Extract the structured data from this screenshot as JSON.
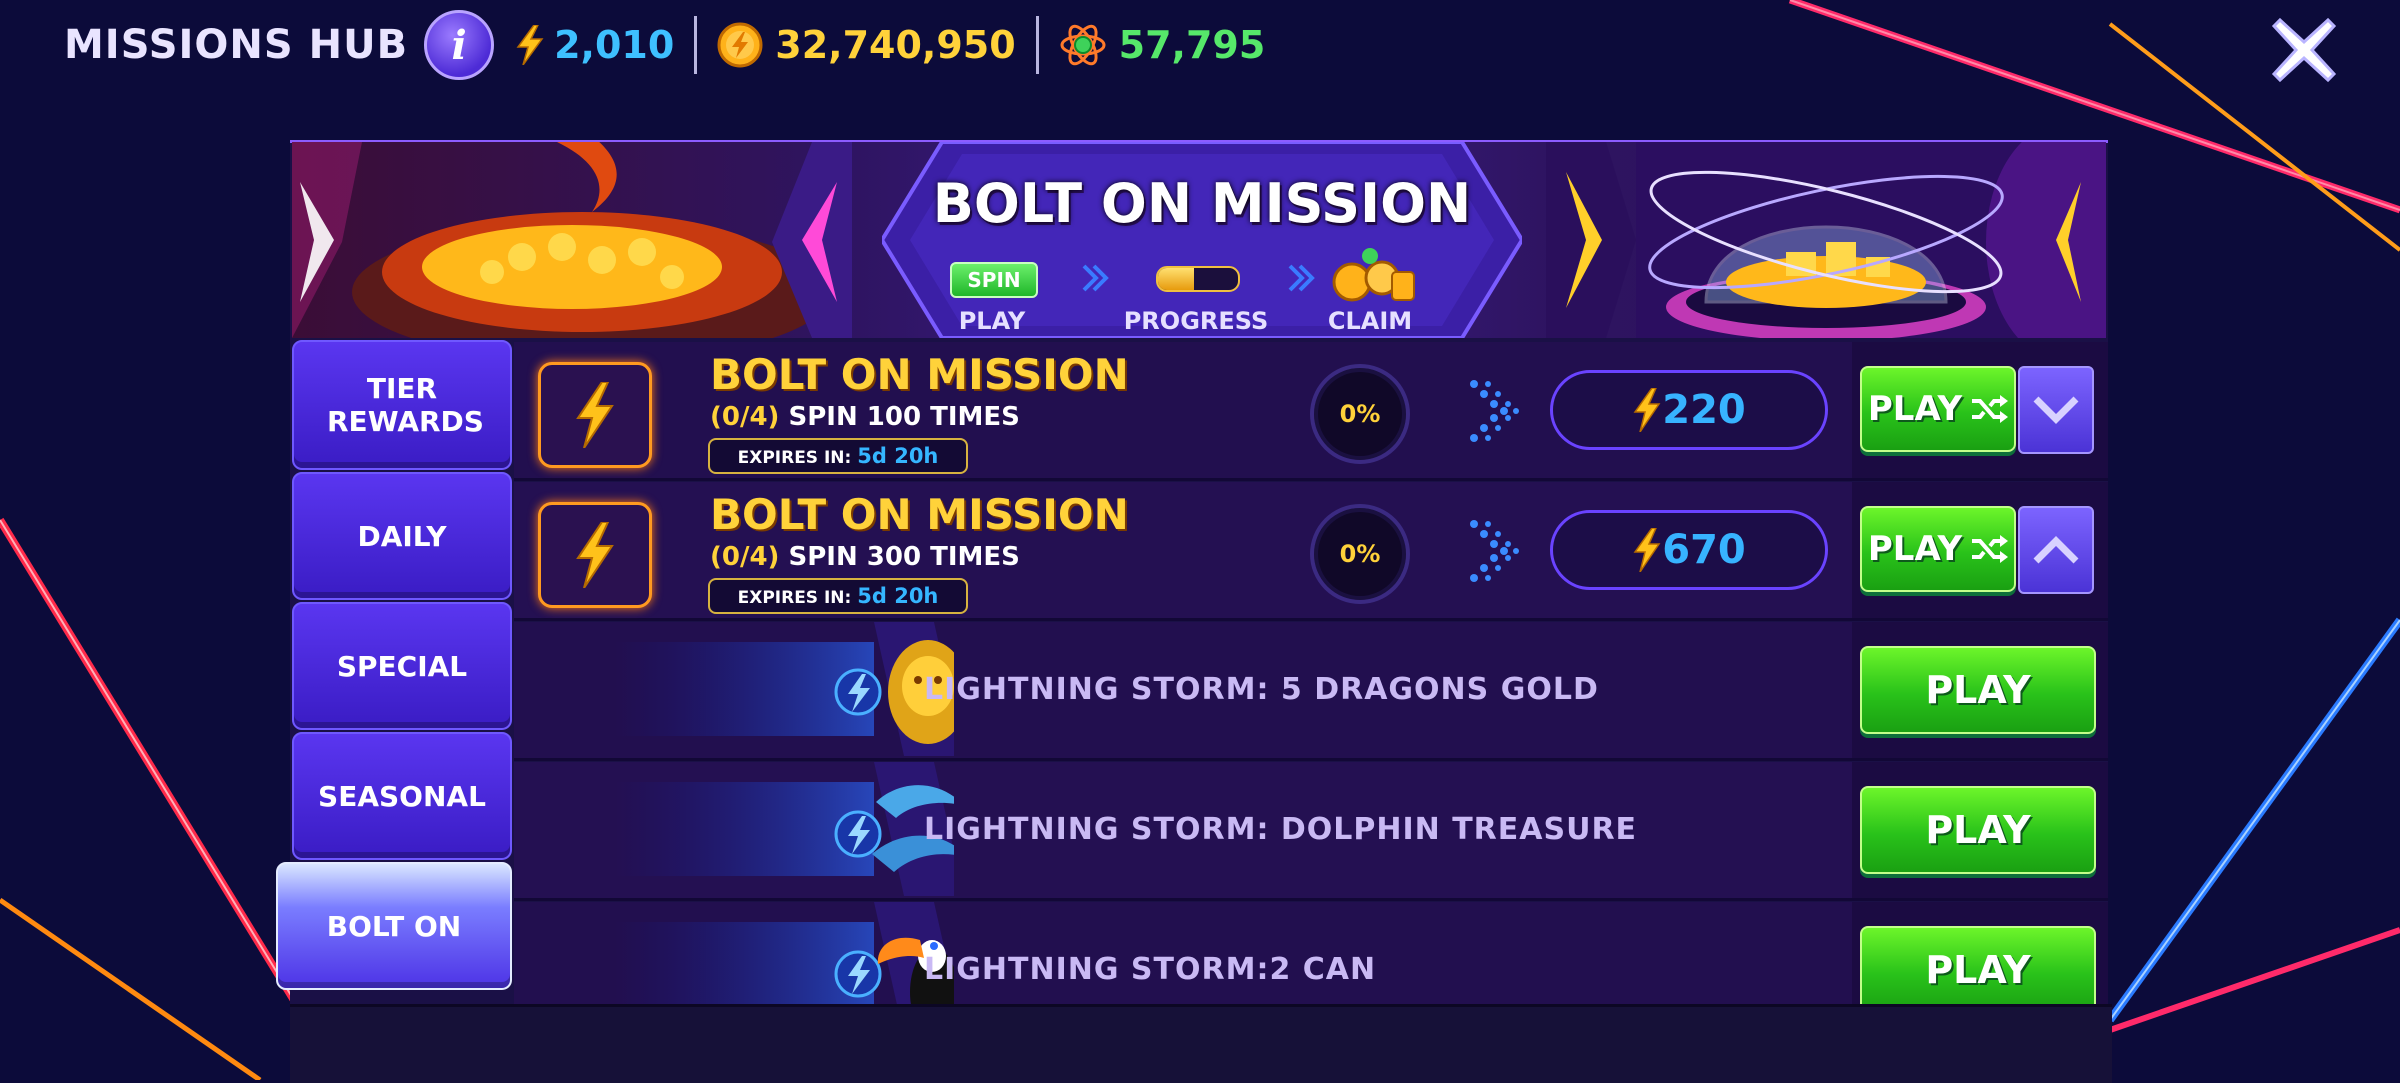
{
  "header": {
    "title": "MISSIONS HUB",
    "info_icon": "i",
    "currencies": [
      {
        "icon": "lightning-bolt-icon",
        "value": "2,010",
        "color": "#3ec0ff"
      },
      {
        "icon": "gold-coin-icon",
        "value": "32,740,950",
        "color": "#ffd23a"
      },
      {
        "icon": "atom-gem-icon",
        "value": "57,795",
        "color": "#56e86a"
      }
    ]
  },
  "banner": {
    "title": "BOLT ON MISSION",
    "steps": [
      {
        "label": "PLAY",
        "badge": "SPIN"
      },
      {
        "label": "PROGRESS",
        "progress": 0.45
      },
      {
        "label": "CLAIM"
      }
    ]
  },
  "tabs": [
    {
      "label": "TIER REWARDS",
      "active": false
    },
    {
      "label": "DAILY",
      "active": false
    },
    {
      "label": "SPECIAL",
      "active": false
    },
    {
      "label": "SEASONAL",
      "active": false
    },
    {
      "label": "BOLT ON",
      "active": true
    }
  ],
  "missions": [
    {
      "title": "BOLT ON MISSION",
      "count": "(0/4)",
      "desc": "SPIN 100 TIMES",
      "expires_label": "EXPIRES IN:",
      "expires_value": "5d 20h",
      "percent": "0%",
      "reward": "220",
      "play_label": "PLAY",
      "toggle": "chevron-down-icon"
    },
    {
      "title": "BOLT ON MISSION",
      "count": "(0/4)",
      "desc": "SPIN 300 TIMES",
      "expires_label": "EXPIRES IN:",
      "expires_value": "5d 20h",
      "percent": "0%",
      "reward": "670",
      "play_label": "PLAY",
      "toggle": "chevron-up-icon"
    }
  ],
  "games": [
    {
      "name": "LIGHTNING STORM: 5 DRAGONS GOLD",
      "thumb": "golden-dragon-icon",
      "play_label": "PLAY"
    },
    {
      "name": "LIGHTNING STORM: DOLPHIN TREASURE",
      "thumb": "dolphins-icon",
      "play_label": "PLAY"
    },
    {
      "name": "LIGHTNING STORM:2 CAN",
      "thumb": "toucan-icon",
      "play_label": "PLAY"
    }
  ]
}
